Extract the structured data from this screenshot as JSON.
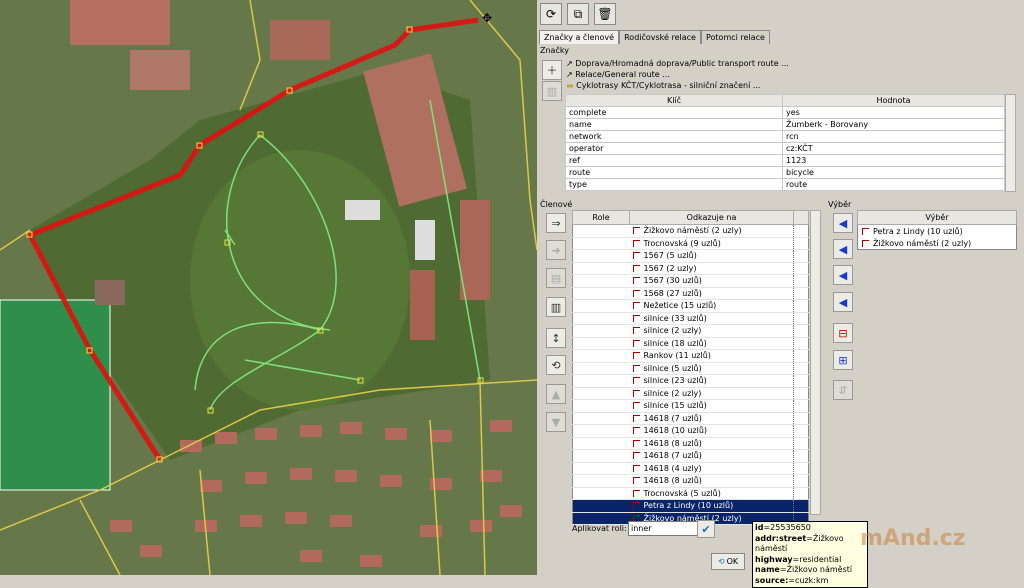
{
  "tabs": [
    {
      "label": "Značky a členové",
      "active": true
    },
    {
      "label": "Rodičovské relace",
      "active": false
    },
    {
      "label": "Potomci relace",
      "active": false
    }
  ],
  "tags_section": {
    "title": "Značky",
    "presets": [
      "Doprava/Hromadná doprava/Public transport route ...",
      "Relace/General route ...",
      "Cyklotrasy KČT/Cyklotrasa - silniční značení ..."
    ],
    "columns": [
      "Klíč",
      "Hodnota"
    ],
    "rows": [
      [
        "complete",
        "yes"
      ],
      [
        "name",
        "Žumberk - Borovany"
      ],
      [
        "network",
        "rcn"
      ],
      [
        "operator",
        "cz:KČT"
      ],
      [
        "ref",
        "1123"
      ],
      [
        "route",
        "bicycle"
      ],
      [
        "type",
        "route"
      ]
    ]
  },
  "members_section": {
    "title": "Členové",
    "columns": [
      "Role",
      "Odkazuje na"
    ],
    "rows": [
      {
        "role": "",
        "ref": "Žižkovo náměstí (2 uzly)",
        "selected": false
      },
      {
        "role": "",
        "ref": "Trocnovská (9 uzlů)",
        "selected": false
      },
      {
        "role": "",
        "ref": "1567 (5 uzlů)",
        "selected": false
      },
      {
        "role": "",
        "ref": "1567 (2 uzly)",
        "selected": false
      },
      {
        "role": "",
        "ref": "1567 (30 uzlů)",
        "selected": false
      },
      {
        "role": "",
        "ref": "1568 (27 uzlů)",
        "selected": false
      },
      {
        "role": "",
        "ref": "Nežetice (15 uzlů)",
        "selected": false
      },
      {
        "role": "",
        "ref": "silnice (33 uzlů)",
        "selected": false
      },
      {
        "role": "",
        "ref": "silnice (2 uzly)",
        "selected": false
      },
      {
        "role": "",
        "ref": "silnice (18 uzlů)",
        "selected": false
      },
      {
        "role": "",
        "ref": "Rankov (11 uzlů)",
        "selected": false
      },
      {
        "role": "",
        "ref": "silnice (5 uzlů)",
        "selected": false
      },
      {
        "role": "",
        "ref": "silnice (23 uzlů)",
        "selected": false
      },
      {
        "role": "",
        "ref": "silnice (2 uzly)",
        "selected": false
      },
      {
        "role": "",
        "ref": "silnice (15 uzlů)",
        "selected": false
      },
      {
        "role": "",
        "ref": "14618 (7 uzlů)",
        "selected": false
      },
      {
        "role": "",
        "ref": "14618 (10 uzlů)",
        "selected": false
      },
      {
        "role": "",
        "ref": "14618 (8 uzlů)",
        "selected": false
      },
      {
        "role": "",
        "ref": "14618 (7 uzlů)",
        "selected": false
      },
      {
        "role": "",
        "ref": "14618 (4 uzly)",
        "selected": false
      },
      {
        "role": "",
        "ref": "14618 (8 uzlů)",
        "selected": false
      },
      {
        "role": "",
        "ref": "Trocnovská (5 uzlů)",
        "selected": false
      },
      {
        "role": "",
        "ref": "Petra z Lindy (10 uzlů)",
        "selected": true
      },
      {
        "role": "",
        "ref": "Žižkovo náměstí (2 uzly)",
        "selected": true
      }
    ],
    "apply_role_label": "Aplikovat roli:",
    "apply_role_value": "inner"
  },
  "selection_section": {
    "title": "Výběr",
    "column": "Výběr",
    "rows": [
      "Petra z Lindy (10 uzlů)",
      "Žižkovo náměstí (2 uzly)"
    ]
  },
  "tooltip": {
    "lines": [
      {
        "k": "id",
        "v": "=25535650"
      },
      {
        "k": "addr:street",
        "v": "=Žižkovo náměstí"
      },
      {
        "k": "highway",
        "v": "=residential"
      },
      {
        "k": "name",
        "v": "=Žižkovo náměstí"
      },
      {
        "k": "source:",
        "v": "=cuzk:km"
      }
    ]
  },
  "ok_label": "OK",
  "watermark": "mAnd.cz",
  "colors": {
    "route": "#e01010",
    "selected": "#0a246a",
    "park": "#5a7a3a",
    "accent_green": "#6ee06e"
  },
  "icons": [
    "refresh-icon",
    "copy-icon",
    "delete-icon",
    "add-icon",
    "arrow-right-icon",
    "edit-icon",
    "trash-icon",
    "sort-icon",
    "reverse-icon",
    "move-up-icon",
    "move-down-icon",
    "add-to-relation-icon",
    "check-icon"
  ]
}
